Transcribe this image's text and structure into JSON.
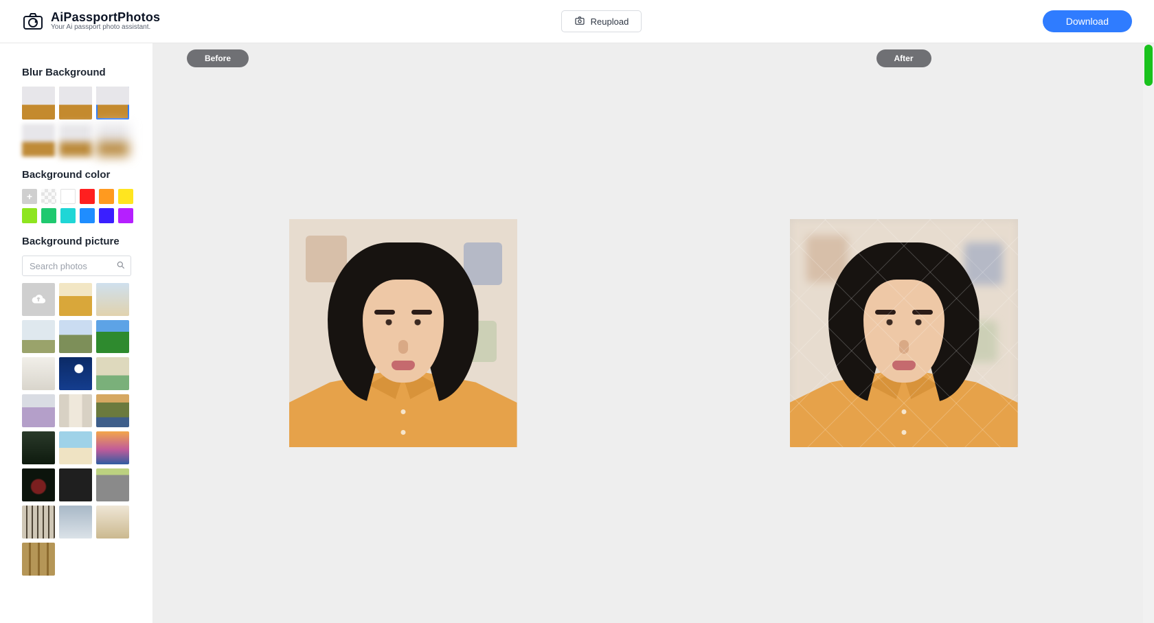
{
  "header": {
    "logo_title": "AiPassportPhotos",
    "logo_subtitle": "Your Ai passport photo assistant.",
    "reupload_label": "Reupload",
    "download_label": "Download"
  },
  "pane": {
    "before_label": "Before",
    "after_label": "After"
  },
  "sidebar": {
    "blur_title": "Blur Background",
    "blur_thumbs": [
      "level-0",
      "level-1",
      "level-2",
      "level-3",
      "level-4",
      "level-5"
    ],
    "blur_selected_index": 2,
    "color_title": "Background color",
    "swatches": [
      {
        "kind": "add"
      },
      {
        "kind": "transparent"
      },
      {
        "kind": "color",
        "hex": "#ffffff",
        "border": true
      },
      {
        "kind": "color",
        "hex": "#ff1f1f"
      },
      {
        "kind": "color",
        "hex": "#ff9a1f"
      },
      {
        "kind": "color",
        "hex": "#ffe51f"
      },
      {
        "kind": "color",
        "hex": "#8ee51f"
      },
      {
        "kind": "color",
        "hex": "#1fc96f"
      },
      {
        "kind": "color",
        "hex": "#1fd6d6"
      },
      {
        "kind": "color",
        "hex": "#1f8dff"
      },
      {
        "kind": "color",
        "hex": "#3a1fff"
      },
      {
        "kind": "color",
        "hex": "#b51fff"
      }
    ],
    "picture_title": "Background picture",
    "search_placeholder": "Search photos",
    "bg_thumbs": [
      "upload",
      "g-field",
      "g-sky",
      "g-tree",
      "g-mtn",
      "g-grass",
      "g-room",
      "g-moon",
      "g-car",
      "g-lav",
      "g-window",
      "g-valley",
      "g-deer",
      "g-beach",
      "g-sunset",
      "g-dark",
      "g-board",
      "g-road",
      "g-forest",
      "g-cloud",
      "g-hall",
      "g-cols"
    ]
  }
}
